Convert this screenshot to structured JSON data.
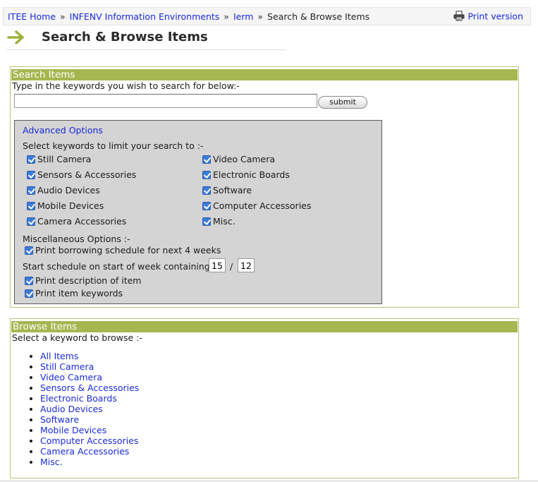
{
  "breadcrumb": {
    "items": [
      "ITEE Home",
      "INFENV Information Environments",
      "Ierm"
    ],
    "separator": "»",
    "current": "Search & Browse Items"
  },
  "print_version": {
    "label": "Print version",
    "icon": "printer-icon"
  },
  "page": {
    "title": "Search & Browse Items",
    "arrow_icon": "right-arrow-icon"
  },
  "search": {
    "header": "Search Items",
    "instruction": "Type in the keywords you wish to search for below:-",
    "input_value": "",
    "submit_label": "submit"
  },
  "advanced": {
    "title": "Advanced Options",
    "keywords_prompt": "Select keywords to limit your search to :-",
    "keywords": [
      {
        "label": "Still Camera",
        "checked": true
      },
      {
        "label": "Sensors & Accessories",
        "checked": true
      },
      {
        "label": "Audio Devices",
        "checked": true
      },
      {
        "label": "Mobile Devices",
        "checked": true
      },
      {
        "label": "Camera Accessories",
        "checked": true
      },
      {
        "label": "Video Camera",
        "checked": true
      },
      {
        "label": "Electronic Boards",
        "checked": true
      },
      {
        "label": "Software",
        "checked": true
      },
      {
        "label": "Computer Accessories",
        "checked": true
      },
      {
        "label": "Misc.",
        "checked": true
      }
    ],
    "misc_heading": "Miscellaneous Options :-",
    "print_schedule_label": "Print borrowing schedule for next 4 weeks",
    "schedule_start_label": "Start schedule on start of week containing:",
    "schedule_day": "15",
    "date_separator": "/",
    "schedule_month": "12",
    "print_description_label": "Print description of item",
    "print_keywords_label": "Print item keywords"
  },
  "browse": {
    "header": "Browse Items",
    "instruction": "Select a keyword to browse :-",
    "items": [
      "All Items",
      "Still Camera",
      "Video Camera",
      "Sensors & Accessories",
      "Electronic Boards",
      "Audio Devices",
      "Software",
      "Mobile Devices",
      "Computer Accessories",
      "Camera Accessories",
      "Misc."
    ]
  },
  "colors": {
    "accent_green": "#a6b650",
    "link_blue": "#1a2ad6",
    "options_gray": "#d4d4d4",
    "checkbox_blue": "#3d7bd9"
  }
}
